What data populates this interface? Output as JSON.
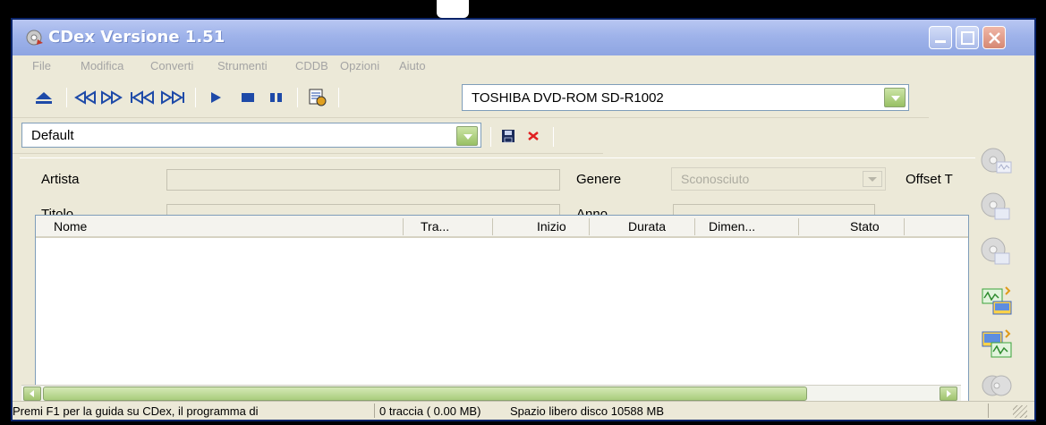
{
  "window": {
    "title": "CDex Versione 1.51",
    "accent": "#0a246a",
    "button_green": "#98c064"
  },
  "menu": {
    "items": [
      "File",
      "Modifica",
      "Converti",
      "Strumenti",
      "CDDB",
      "Opzioni",
      "Aiuto"
    ]
  },
  "toolbar": {
    "icons": [
      "eject-icon",
      "rewind-icon",
      "fast-forward-icon",
      "previous-track-icon",
      "next-track-icon",
      "play-icon",
      "stop-icon",
      "pause-icon",
      "cd-info-icon"
    ],
    "drive": "TOSHIBA DVD-ROM SD-R1002"
  },
  "profile": {
    "value": "Default",
    "icons": [
      "save-icon",
      "delete-icon"
    ]
  },
  "form": {
    "artist_label": "Artista",
    "title_label": "Titolo",
    "genre_label": "Genere",
    "genre_value": "Sconosciuto",
    "year_label": "Anno",
    "offset_label": "Offset T"
  },
  "tracklist": {
    "columns": [
      "Nome",
      "Tra...",
      "Inizio",
      "Durata",
      "Dimen...",
      "Stato"
    ],
    "rows": []
  },
  "sidebar": {
    "buttons": [
      "extract-wav-icon",
      "extract-mp3-icon",
      "extract-partial-icon",
      "convert-wav-mp3-icon",
      "convert-mp3-wav-icon",
      "record-icon"
    ]
  },
  "status": {
    "help": "Premi F1 per la guida su CDex, il programma di",
    "tracks": "0 traccia ( 0.00 MB)",
    "disk": "Spazio libero disco 10588 MB"
  }
}
